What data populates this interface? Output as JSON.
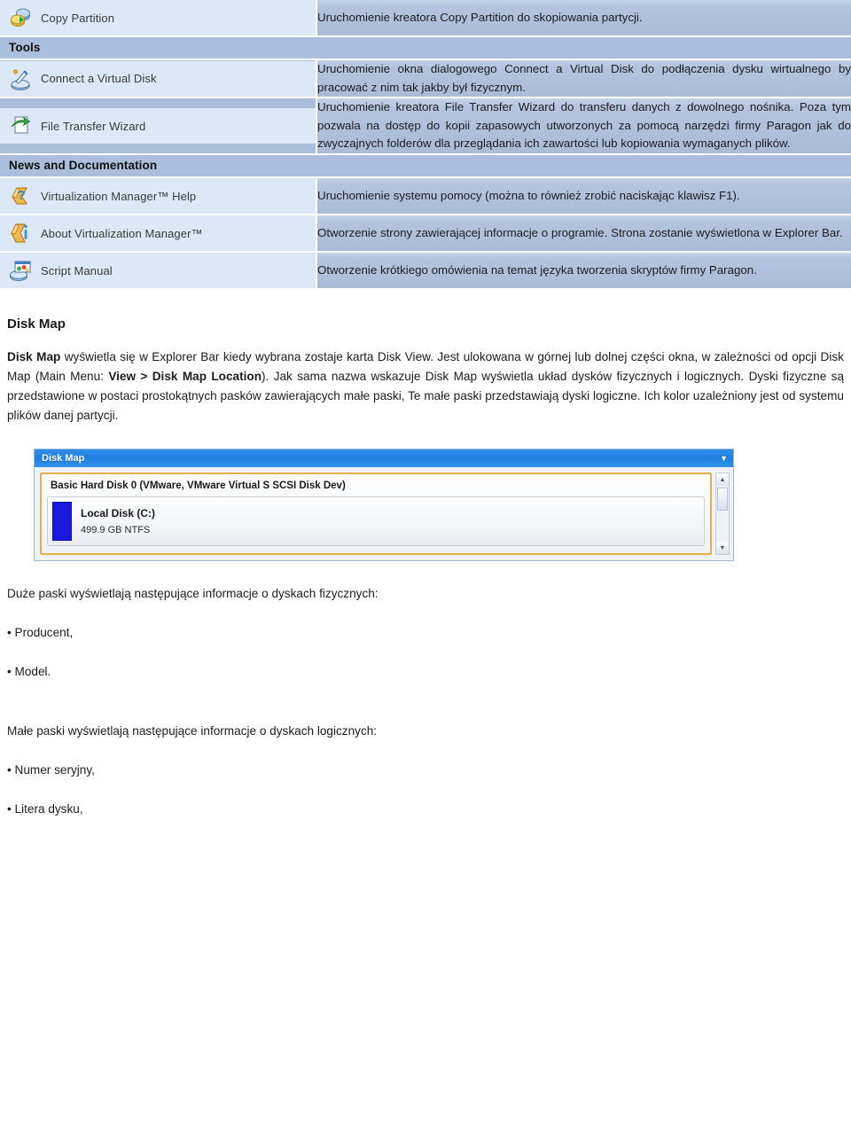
{
  "colors": {
    "table_cell_left_bg": "#aabfdb",
    "table_cell_right_bg": "#b2c4de",
    "pill_bg": "#dce8f7",
    "section_header_bg": "#aabfdb",
    "diskmap_title_bg": "#1f7fe0",
    "diskmap_disk_border": "#e3b04b",
    "ntfs_swatch": "#1918e0"
  },
  "feature_table": {
    "rows": [
      {
        "kind": "item",
        "icon": "copy-partition-icon",
        "label": "Copy Partition",
        "description": "Uruchomienie kreatora Copy Partition do skopiowania partycji."
      },
      {
        "kind": "section",
        "label": "Tools"
      },
      {
        "kind": "item",
        "icon": "connect-virtual-disk-icon",
        "label": "Connect a Virtual Disk",
        "description": "Uruchomienie okna dialogowego Connect a Virtual Disk do podłączenia dysku wirtualnego by pracować z nim tak jakby był fizycznym."
      },
      {
        "kind": "item",
        "icon": "file-transfer-wizard-icon",
        "label": "File Transfer Wizard",
        "description": "Uruchomienie kreatora File Transfer Wizard do transferu danych z dowolnego nośnika. Poza tym pozwala na dostęp do kopii zapasowych utworzonych za pomocą narzędzi firmy Paragon jak do zwyczajnych folderów dla przeglądania ich zawartości lub kopiowania wymaganych plików."
      },
      {
        "kind": "section",
        "label": "News and Documentation"
      },
      {
        "kind": "item",
        "icon": "help-question-icon",
        "label": "Virtualization Manager™ Help",
        "description": "Uruchomienie systemu pomocy (można to również zrobić naciskając klawisz F1)."
      },
      {
        "kind": "item",
        "icon": "about-info-icon",
        "label": "About Virtualization Manager™",
        "description": "Otworzenie strony zawierającej informacje o programie. Strona zostanie wyświetlona w Explorer Bar."
      },
      {
        "kind": "item",
        "icon": "script-manual-icon",
        "label": "Script Manual",
        "description": "Otworzenie krótkiego omówienia na temat języka tworzenia skryptów firmy Paragon."
      }
    ]
  },
  "disk_map_section": {
    "heading": "Disk Map",
    "paragraph": {
      "p1_bold": "Disk Map",
      "p2": " wyświetla się w  Explorer Bar kiedy wybrana zostaje karta Disk View. Jest ulokowana w górnej lub dolnej części okna, w zależności od opcji  Disk Map (Main Menu: ",
      "p3_bold": "View > Disk Map Location",
      "p4": "). Jak sama nazwa wskazuje Disk Map wyświetla układ dysków fizycznych i logicznych. Dyski fizyczne są przedstawione w postaci prostokątnych pasków zawierających małe paski, Te małe paski przedstawiają dyski logiczne. Ich kolor uzależniony jest od systemu plików danej partycji."
    }
  },
  "disk_map_widget": {
    "title": "Disk Map",
    "collapse_caret": "▼",
    "disk_label": "Basic Hard Disk 0 (VMware, VMware Virtual S SCSI Disk Dev)",
    "volume_name": "Local Disk (C:)",
    "volume_size": "499.9 GB NTFS",
    "scroll_up": "▲",
    "scroll_down": "▼"
  },
  "info_lists": {
    "physical_lead": "Duże paski wyświetlają następujące informacje o dyskach fizycznych:",
    "physical_items": [
      "• Producent,",
      "• Model."
    ],
    "logical_lead": "Małe paski wyświetlają następujące informacje o dyskach logicznych:",
    "logical_items": [
      "• Numer seryjny,",
      "• Litera dysku,"
    ]
  }
}
